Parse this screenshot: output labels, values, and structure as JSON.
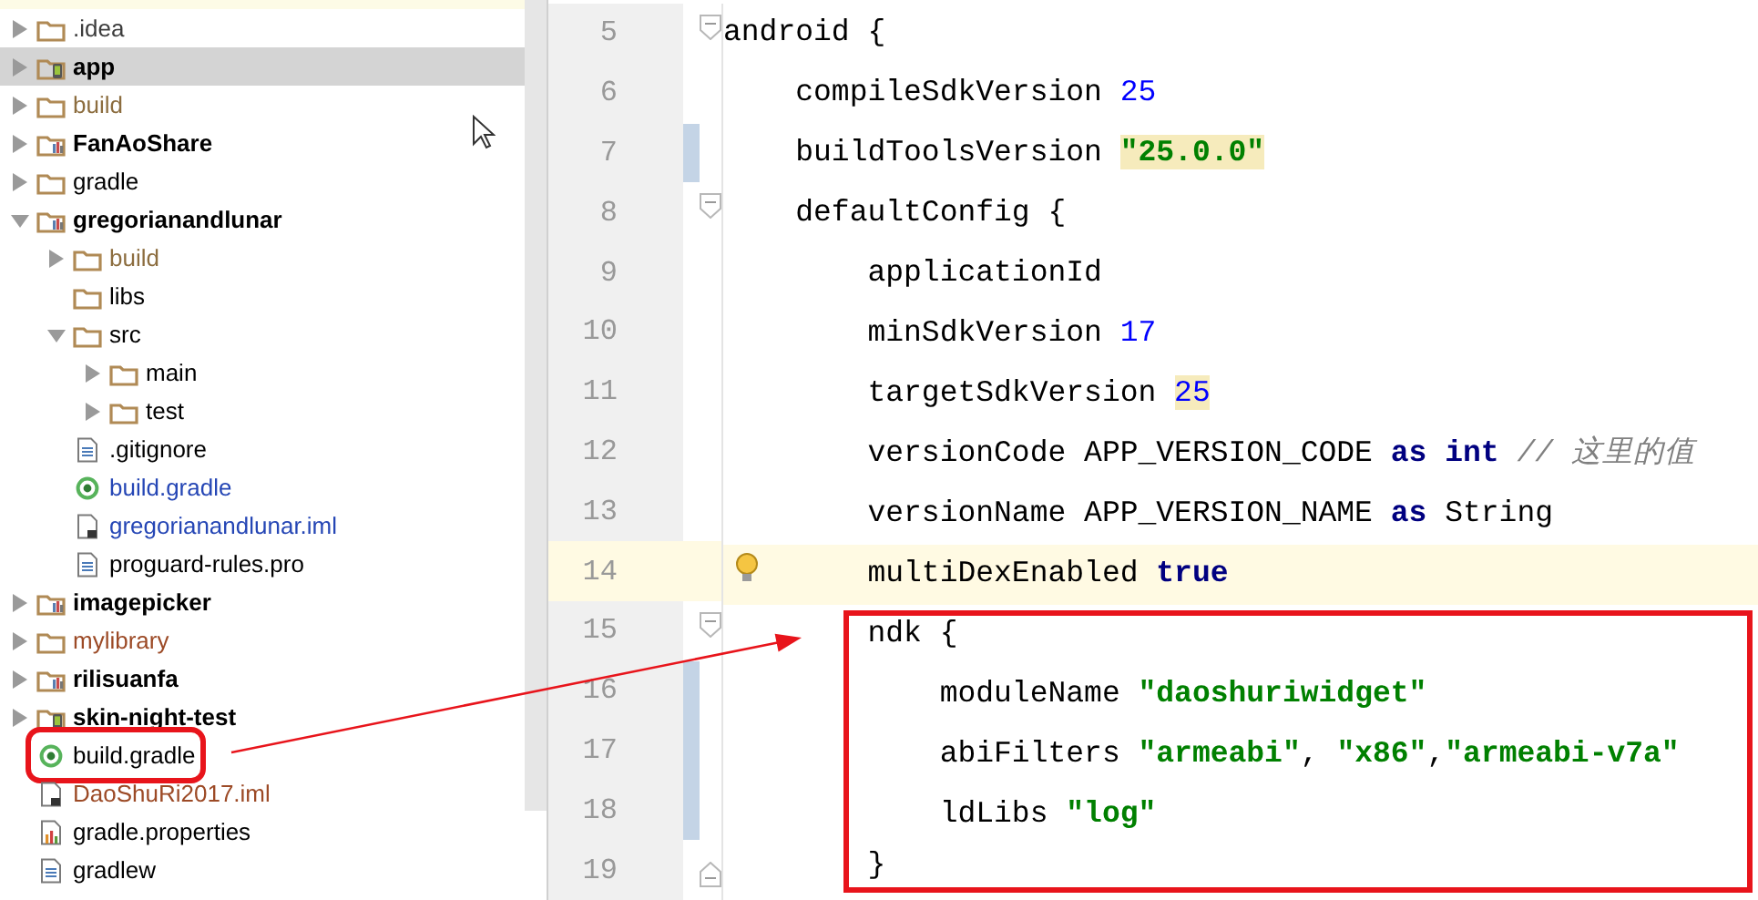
{
  "project_tree": {
    "items": [
      {
        "name": ".idea",
        "kind": "folder",
        "expanded": false,
        "selected": false,
        "bold": false,
        "boxed": false,
        "color": "#3c3c3c"
      },
      {
        "name": "app",
        "kind": "appmodule",
        "expanded": false,
        "selected": true,
        "bold": true,
        "boxed": false,
        "color": "#000000"
      },
      {
        "name": "build",
        "kind": "folder",
        "expanded": false,
        "selected": false,
        "bold": false,
        "boxed": false,
        "color": "#8c6d3f"
      },
      {
        "name": "FanAoShare",
        "kind": "module",
        "expanded": false,
        "selected": false,
        "bold": true,
        "boxed": false,
        "color": "#000000"
      },
      {
        "name": "gradle",
        "kind": "folder",
        "expanded": false,
        "selected": false,
        "bold": false,
        "boxed": false,
        "color": "#000000"
      },
      {
        "name": "gregorianandlunar",
        "kind": "module",
        "expanded": true,
        "selected": false,
        "bold": true,
        "boxed": false,
        "color": "#000000",
        "children": [
          {
            "name": "build",
            "kind": "folder",
            "expanded": false,
            "selected": false,
            "bold": false,
            "boxed": false,
            "color": "#8c6d3f"
          },
          {
            "name": "libs",
            "kind": "folder",
            "selected": false,
            "bold": false,
            "boxed": false,
            "color": "#000000"
          },
          {
            "name": "src",
            "kind": "folder",
            "expanded": true,
            "selected": false,
            "bold": false,
            "boxed": false,
            "color": "#000000",
            "children": [
              {
                "name": "main",
                "kind": "folder",
                "expanded": false,
                "selected": false,
                "bold": false,
                "boxed": false,
                "color": "#000000"
              },
              {
                "name": "test",
                "kind": "folder",
                "expanded": false,
                "selected": false,
                "bold": false,
                "boxed": false,
                "color": "#000000"
              }
            ]
          },
          {
            "name": ".gitignore",
            "kind": "textfile",
            "selected": false,
            "bold": false,
            "boxed": false,
            "color": "#000000"
          },
          {
            "name": "build.gradle",
            "kind": "gradle",
            "selected": false,
            "bold": false,
            "boxed": false,
            "color": "#2546b5"
          },
          {
            "name": "gregorianandlunar.iml",
            "kind": "iml",
            "selected": false,
            "bold": false,
            "boxed": false,
            "color": "#2546b5"
          },
          {
            "name": "proguard-rules.pro",
            "kind": "textfile",
            "selected": false,
            "bold": false,
            "boxed": false,
            "color": "#000000"
          }
        ]
      },
      {
        "name": "imagepicker",
        "kind": "module",
        "expanded": false,
        "selected": false,
        "bold": true,
        "boxed": false,
        "color": "#000000"
      },
      {
        "name": "mylibrary",
        "kind": "folder",
        "expanded": false,
        "selected": false,
        "bold": false,
        "boxed": false,
        "color": "#9c4a26"
      },
      {
        "name": "rilisuanfa",
        "kind": "module",
        "expanded": false,
        "selected": false,
        "bold": true,
        "boxed": false,
        "color": "#000000"
      },
      {
        "name": "skin-night-test",
        "kind": "appmodule",
        "expanded": false,
        "selected": false,
        "bold": true,
        "boxed": false,
        "color": "#000000"
      },
      {
        "name": "build.gradle",
        "kind": "gradle",
        "selected": false,
        "bold": false,
        "boxed": true,
        "color": "#000000"
      },
      {
        "name": "DaoShuRi2017.iml",
        "kind": "iml",
        "selected": false,
        "bold": false,
        "boxed": false,
        "color": "#9c4a26"
      },
      {
        "name": "gradle.properties",
        "kind": "properties",
        "selected": false,
        "bold": false,
        "boxed": false,
        "color": "#000000"
      },
      {
        "name": "gradlew",
        "kind": "textfile",
        "selected": false,
        "bold": false,
        "boxed": false,
        "color": "#000000"
      }
    ]
  },
  "editor": {
    "annotation_arrow": true,
    "lines": [
      {
        "number": "5",
        "fold_start": true,
        "fold_end": false,
        "changed": false,
        "current": false,
        "bulb": false,
        "tokens": [
          {
            "kind": "plain",
            "text": "android {"
          }
        ]
      },
      {
        "number": "6",
        "fold_start": false,
        "fold_end": false,
        "changed": false,
        "current": false,
        "bulb": false,
        "tokens": [
          {
            "kind": "plain",
            "text": "    compileSdkVersion "
          },
          {
            "kind": "number",
            "text": "25"
          }
        ]
      },
      {
        "number": "7",
        "fold_start": false,
        "fold_end": false,
        "changed": true,
        "current": false,
        "bulb": false,
        "tokens": [
          {
            "kind": "plain",
            "text": "    buildToolsVersion "
          },
          {
            "kind": "string",
            "text": "\"25.0.0\"",
            "highlighted": true
          }
        ]
      },
      {
        "number": "8",
        "fold_start": true,
        "fold_end": false,
        "changed": false,
        "current": false,
        "bulb": false,
        "tokens": [
          {
            "kind": "plain",
            "text": "    defaultConfig {"
          }
        ]
      },
      {
        "number": "9",
        "fold_start": false,
        "fold_end": false,
        "changed": false,
        "current": false,
        "bulb": false,
        "tokens": [
          {
            "kind": "plain",
            "text": "        applicationId"
          }
        ]
      },
      {
        "number": "10",
        "fold_start": false,
        "fold_end": false,
        "changed": false,
        "current": false,
        "bulb": false,
        "tokens": [
          {
            "kind": "plain",
            "text": "        minSdkVersion "
          },
          {
            "kind": "number",
            "text": "17"
          }
        ]
      },
      {
        "number": "11",
        "fold_start": false,
        "fold_end": false,
        "changed": false,
        "current": false,
        "bulb": false,
        "tokens": [
          {
            "kind": "plain",
            "text": "        targetSdkVersion "
          },
          {
            "kind": "number",
            "text": "25",
            "highlighted": true
          }
        ]
      },
      {
        "number": "12",
        "fold_start": false,
        "fold_end": false,
        "changed": false,
        "current": false,
        "bulb": false,
        "tokens": [
          {
            "kind": "plain",
            "text": "        versionCode APP_VERSION_CODE "
          },
          {
            "kind": "keyword",
            "text": "as int"
          },
          {
            "kind": "comment",
            "text": " // 这里的值"
          }
        ]
      },
      {
        "number": "13",
        "fold_start": false,
        "fold_end": false,
        "changed": false,
        "current": false,
        "bulb": false,
        "tokens": [
          {
            "kind": "plain",
            "text": "        versionName APP_VERSION_NAME "
          },
          {
            "kind": "keyword",
            "text": "as"
          },
          {
            "kind": "plain",
            "text": " String"
          }
        ]
      },
      {
        "number": "14",
        "fold_start": false,
        "fold_end": false,
        "changed": false,
        "current": true,
        "bulb": true,
        "tokens": [
          {
            "kind": "plain",
            "text": "        multiDexEnabled "
          },
          {
            "kind": "keyword",
            "text": "true"
          }
        ]
      }
    ],
    "framed_lines": [
      {
        "number": "15",
        "fold_start": true,
        "fold_end": false,
        "changed": false,
        "current": false,
        "bulb": false,
        "tokens": [
          {
            "kind": "plain",
            "text": "        ndk {"
          }
        ]
      },
      {
        "number": "16",
        "fold_start": false,
        "fold_end": false,
        "changed": true,
        "current": false,
        "bulb": false,
        "tokens": [
          {
            "kind": "plain",
            "text": "            moduleName "
          },
          {
            "kind": "string",
            "text": "\"daoshuriwidget\""
          }
        ]
      },
      {
        "number": "17",
        "fold_start": false,
        "fold_end": false,
        "changed": true,
        "current": false,
        "bulb": false,
        "tokens": [
          {
            "kind": "plain",
            "text": "            abiFilters "
          },
          {
            "kind": "string",
            "text": "\"armeabi\""
          },
          {
            "kind": "plain",
            "text": ", "
          },
          {
            "kind": "string",
            "text": "\"x86\""
          },
          {
            "kind": "plain",
            "text": ","
          },
          {
            "kind": "string",
            "text": "\"armeabi-v7a\""
          }
        ]
      },
      {
        "number": "18",
        "fold_start": false,
        "fold_end": false,
        "changed": true,
        "current": false,
        "bulb": false,
        "tokens": [
          {
            "kind": "plain",
            "text": "            ldLibs "
          },
          {
            "kind": "string",
            "text": "\"log\""
          }
        ]
      },
      {
        "number": "19",
        "fold_start": false,
        "fold_end": true,
        "changed": false,
        "current": false,
        "bulb": false,
        "tokens": [
          {
            "kind": "plain",
            "text": "        }"
          }
        ]
      }
    ]
  }
}
